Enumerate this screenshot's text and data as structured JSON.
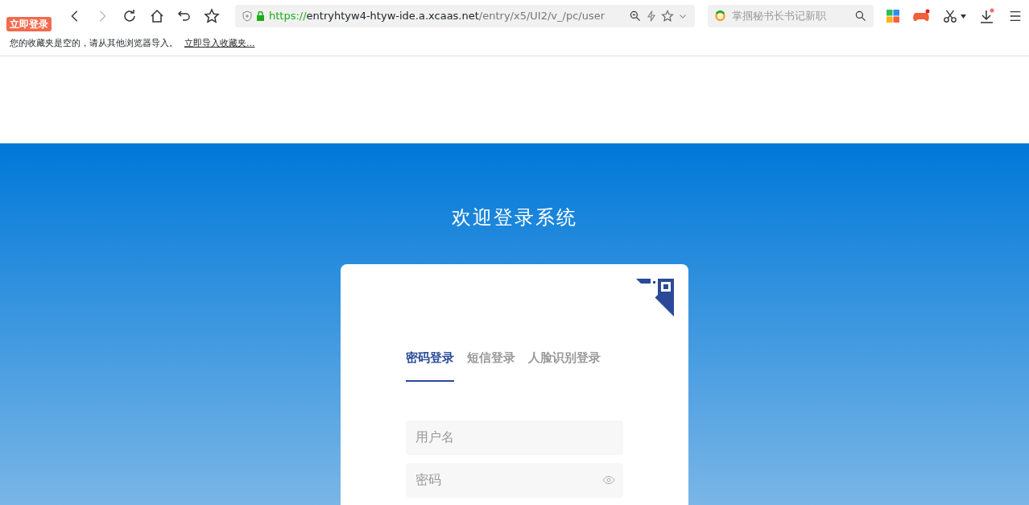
{
  "browser": {
    "login_badge": "立即登录",
    "url": {
      "scheme": "https://",
      "host": "entryhtyw4-htyw-ide.a.xcaas.net",
      "path": "/entry/x5/UI2/v_/pc/user"
    },
    "search_placeholder": "掌掴秘书长书记新职"
  },
  "bookmarks_bar": {
    "message": "您的收藏夹是空的，请从其他浏览器导入。",
    "link": "立即导入收藏夹..."
  },
  "page": {
    "title": "欢迎登录系统",
    "tabs": [
      {
        "label": "密码登录",
        "selected": true
      },
      {
        "label": "短信登录",
        "selected": false
      },
      {
        "label": "人脸识别登录",
        "selected": false
      }
    ],
    "fields": [
      {
        "kind": "text",
        "placeholder": "用户名"
      },
      {
        "kind": "password",
        "placeholder": "密码"
      }
    ]
  }
}
